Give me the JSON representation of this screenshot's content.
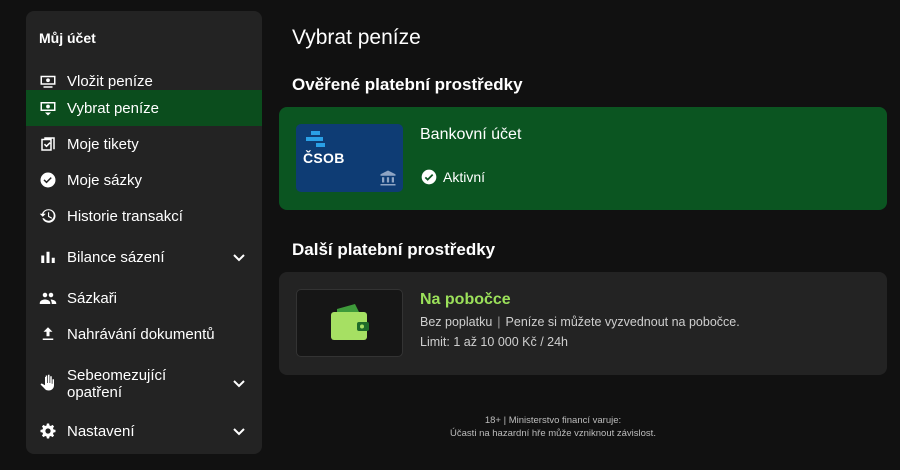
{
  "sidebar": {
    "title": "Můj účet",
    "items": [
      {
        "label": "Vložit peníze",
        "icon": "deposit-icon"
      },
      {
        "label": "Vybrat peníze",
        "icon": "withdraw-icon",
        "active": true
      },
      {
        "label": "Moje tikety",
        "icon": "ticket-icon"
      },
      {
        "label": "Moje sázky",
        "icon": "check-circle-icon"
      },
      {
        "label": "Historie transakcí",
        "icon": "history-icon"
      },
      {
        "label": "Bilance sázení",
        "icon": "bar-chart-icon",
        "expandable": true
      },
      {
        "label": "Sázkaři",
        "icon": "people-icon"
      },
      {
        "label": "Nahrávání dokumentů",
        "icon": "upload-icon"
      },
      {
        "label_line1": "Sebeomezující",
        "label_line2": "opatření",
        "icon": "hand-icon",
        "expandable": true
      },
      {
        "label": "Nastavení",
        "icon": "gear-icon",
        "expandable": true
      }
    ]
  },
  "main": {
    "title": "Vybrat peníze",
    "verified_section": {
      "title": "Ověřené platební prostředky",
      "card": {
        "logo_text": "ČSOB",
        "name": "Bankovní účet",
        "status": "Aktivní"
      }
    },
    "other_section": {
      "title": "Další platební prostředky",
      "card": {
        "name": "Na pobočce",
        "fee": "Bez poplatku",
        "separator": "|",
        "description": "Peníze si můžete vyzvednout na pobočce.",
        "limit": "Limit: 1 až 10 000 Kč / 24h"
      }
    }
  },
  "footer": {
    "line1": "18+ | Ministerstvo financí varuje:",
    "line2": "Účasti na hazardní hře může vzniknout závislost."
  },
  "colors": {
    "background": "#111111",
    "panel": "#232323",
    "active_nav": "#0b4d1d",
    "verified_card": "#0b5521",
    "accent_green": "#9be05a",
    "csob_blue": "#0e3c74"
  }
}
